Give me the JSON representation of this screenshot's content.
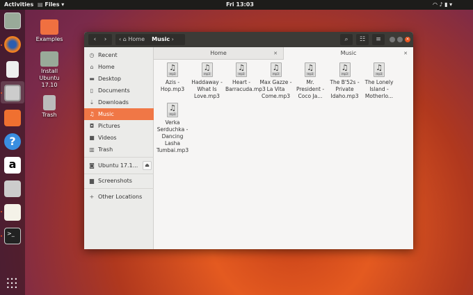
{
  "topbar": {
    "activities": "Activities",
    "app_menu": "Files",
    "clock": "Fri 13:03"
  },
  "dock": [
    "ubuntu-installer",
    "firefox",
    "rhythmbox",
    "files",
    "software",
    "help",
    "amazon",
    "screenshot",
    "text-editor",
    "terminal",
    "show-applications"
  ],
  "desktop": [
    {
      "label": "Examples"
    },
    {
      "label": "Install Ubuntu 17.10"
    },
    {
      "label": "Trash"
    }
  ],
  "window": {
    "path": {
      "home": "Home",
      "current": "Music"
    },
    "sidebar": [
      {
        "label": "Recent",
        "icon": "clock"
      },
      {
        "label": "Home",
        "icon": "home"
      },
      {
        "label": "Desktop",
        "icon": "folder"
      },
      {
        "label": "Documents",
        "icon": "document"
      },
      {
        "label": "Downloads",
        "icon": "download"
      },
      {
        "label": "Music",
        "icon": "music",
        "active": true
      },
      {
        "label": "Pictures",
        "icon": "camera"
      },
      {
        "label": "Videos",
        "icon": "video"
      },
      {
        "label": "Trash",
        "icon": "trash"
      }
    ],
    "device": "Ubuntu 17.1...",
    "bookmarks": [
      {
        "label": "Screenshots"
      }
    ],
    "other": "Other Locations",
    "tabs": [
      {
        "label": "Home"
      },
      {
        "label": "Music",
        "active": true
      }
    ],
    "files": [
      "Azis - Hop.mp3",
      "Haddaway - What Is Love.mp3",
      "Heart - Barracuda.mp3",
      "Max Gazze - La Vita Come.mp3",
      "Mr. President - Coco Ja...",
      "The B'52s - Private Idaho.mp3",
      "The Lonely Island - Motherlo...",
      "Verka Serduchka - Dancing Lasha Tumbai.mp3"
    ],
    "file_badge": "mp3",
    "accent": "#f07746"
  }
}
